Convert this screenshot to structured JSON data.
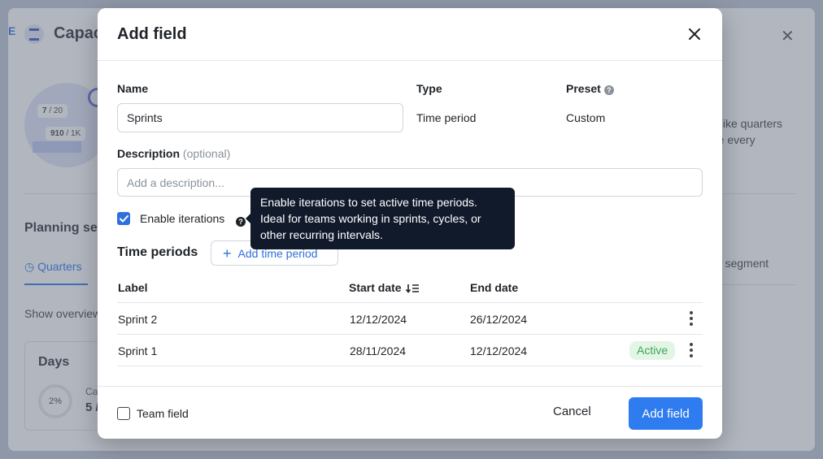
{
  "background": {
    "edge_tab": "E",
    "title": "Capac",
    "chip1": {
      "a": "7",
      "b": "/ 20"
    },
    "chip2": {
      "a": "910",
      "b": "/ 1K"
    },
    "right_text_line1": ", like quarters",
    "right_text_line2": "re every",
    "planning_title": "Planning seg",
    "tab_quarters": "Quarters",
    "right_tab_text": "ng segment",
    "show_text": "Show overview",
    "days_title": "Days",
    "days_percent": "2%",
    "days_caption": "Ca",
    "days_value": "5 /"
  },
  "modal": {
    "title": "Add field",
    "name_label": "Name",
    "name_value": "Sprints",
    "type_label": "Type",
    "type_value": "Time period",
    "preset_label": "Preset",
    "preset_value": "Custom",
    "description_label": "Description",
    "description_optional": "(optional)",
    "description_placeholder": "Add a description...",
    "enable_iterations_label": "Enable iterations",
    "enable_iterations_checked": true,
    "tooltip_lines": [
      "Enable iterations to set active time periods.",
      "Ideal for teams working in sprints, cycles, or",
      "other recurring intervals."
    ],
    "time_periods_title": "Time periods",
    "add_time_period_label": "Add time period",
    "table": {
      "columns": [
        "Label",
        "Start date",
        "End date"
      ],
      "rows": [
        {
          "label": "Sprint 2",
          "start": "12/12/2024",
          "end": "26/12/2024",
          "status": ""
        },
        {
          "label": "Sprint 1",
          "start": "28/11/2024",
          "end": "12/12/2024",
          "status": "Active"
        }
      ]
    },
    "team_field_label": "Team field",
    "team_field_checked": false,
    "cancel_label": "Cancel",
    "submit_label": "Add field"
  },
  "colors": {
    "primary": "#2f7cf0",
    "checkbox_checked": "#2f6fde",
    "tooltip_bg": "#111a2b",
    "active_badge_bg": "#e3f6e6",
    "active_badge_text": "#3aa655"
  }
}
